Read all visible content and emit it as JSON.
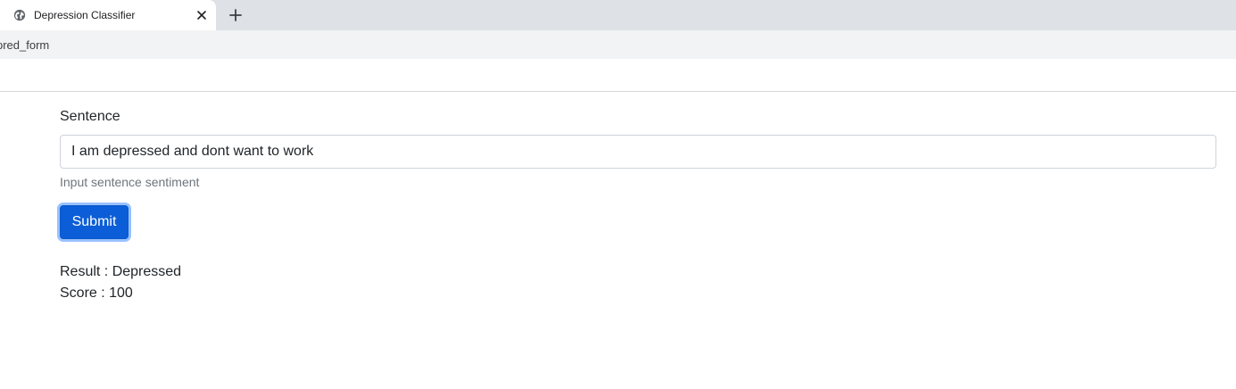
{
  "browser": {
    "tab": {
      "title": "Depression Classifier",
      "favicon": "globe-icon"
    },
    "close_icon": "close-icon",
    "new_tab_icon": "plus-icon",
    "url_fragment": "pred_form"
  },
  "form": {
    "label": "Sentence",
    "input_value": "I am depressed and dont want to work",
    "help_text": "Input sentence sentiment",
    "submit_label": "Submit"
  },
  "result": {
    "result_text": "Result : Depressed",
    "score_text": "Score : 100"
  },
  "colors": {
    "primary_button": "#0b5ed7",
    "tab_strip": "#dee1e6",
    "address_bar": "#f1f3f4"
  }
}
